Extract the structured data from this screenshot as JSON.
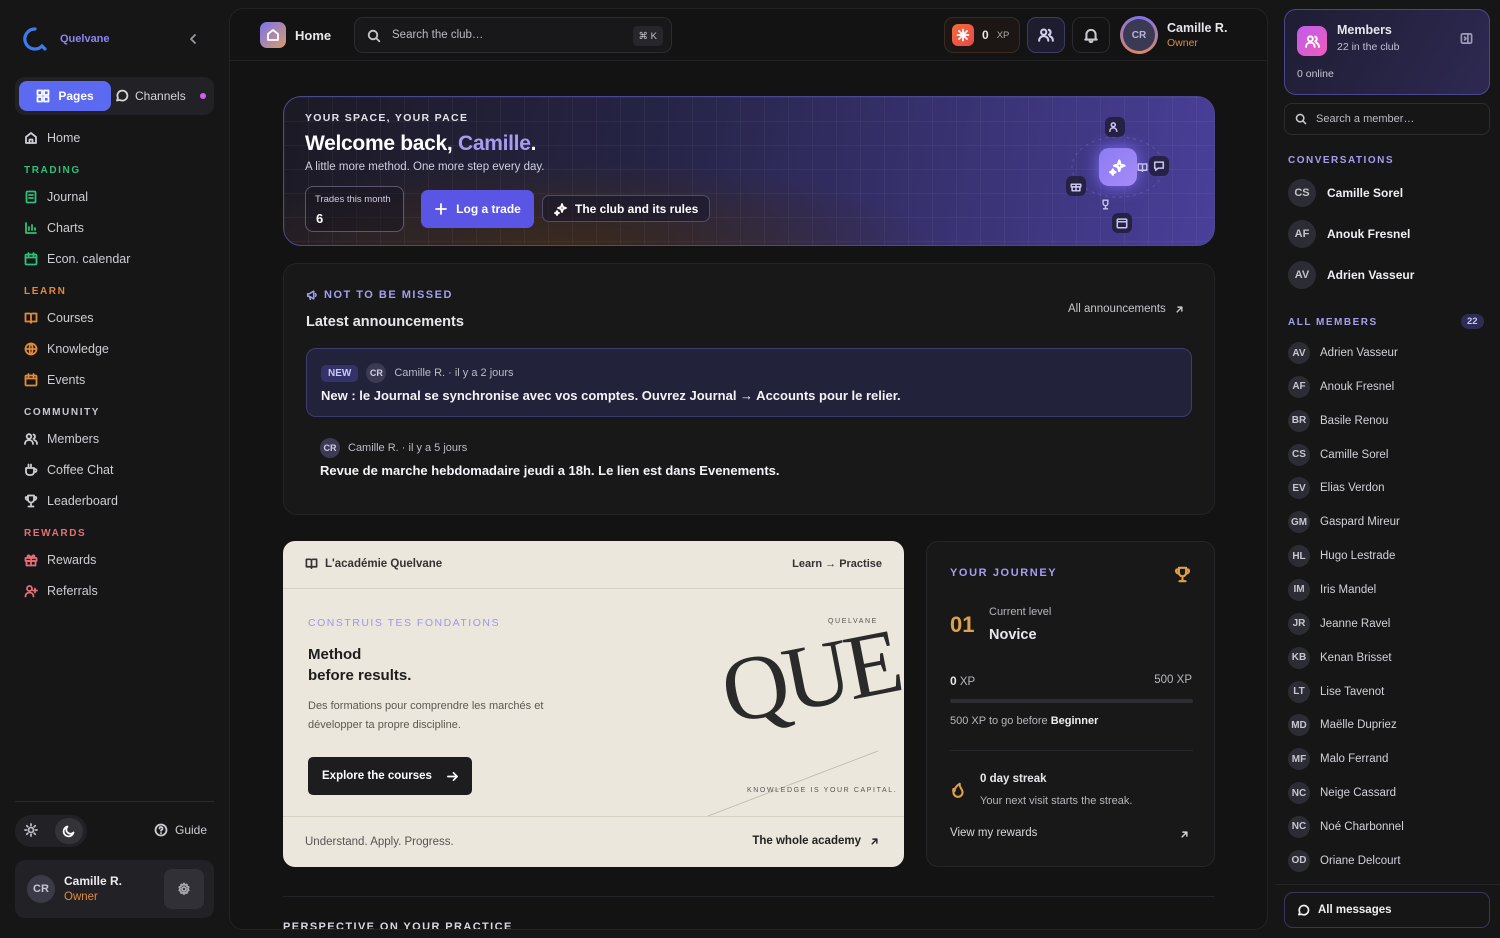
{
  "brand": {
    "name": "Quelvane"
  },
  "left_nav": {
    "tabs": {
      "pages": "Pages",
      "channels": "Channels"
    },
    "home": "Home",
    "sections": [
      {
        "title": "TRADING",
        "color": "#2fbf7a",
        "items": [
          "Journal",
          "Charts",
          "Econ. calendar"
        ]
      },
      {
        "title": "LEARN",
        "color": "#e08a3c",
        "items": [
          "Courses",
          "Knowledge",
          "Events"
        ]
      },
      {
        "title": "COMMUNITY",
        "color": "#c9c7d0",
        "items": [
          "Members",
          "Coffee Chat",
          "Leaderboard"
        ]
      },
      {
        "title": "REWARDS",
        "color": "#e36f78",
        "items": [
          "Rewards",
          "Referrals"
        ]
      }
    ],
    "guide": "Guide",
    "profile": {
      "initials": "CR",
      "name": "Camille R.",
      "role": "Owner"
    }
  },
  "topbar": {
    "page": "Home",
    "search_placeholder": "Search the club…",
    "shortcut": "⌘ K",
    "xp_value": "0",
    "xp_unit": "XP",
    "user": {
      "initials": "CR",
      "name": "Camille R.",
      "role": "Owner"
    }
  },
  "welcome": {
    "kicker": "YOUR SPACE, YOUR PACE",
    "greeting": "Welcome back, ",
    "name": "Camille",
    "period": ".",
    "subtitle": "A little more method. One more step every day.",
    "trades_label": "Trades this month",
    "trades_value": "6",
    "log_trade": "Log a trade",
    "rules": "The club and its rules"
  },
  "announcements": {
    "kicker": "NOT TO BE MISSED",
    "title": "Latest announcements",
    "all_link": "All announcements",
    "posts": [
      {
        "badge": "NEW",
        "initials": "CR",
        "meta": "Camille R. · il y a 2 jours",
        "body": "New : le Journal se synchronise avec vos comptes. Ouvrez Journal → Accounts pour le relier."
      },
      {
        "initials": "CR",
        "meta": "Camille R. · il y a 5 jours",
        "body": "Revue de marche hebdomadaire jeudi a 18h. Le lien est dans Evenements."
      }
    ]
  },
  "academy": {
    "title": "L'académie Quelvane",
    "tagline": "Learn → Practise",
    "kicker": "CONSTRUIS TES FONDATIONS",
    "heading_1": "Method",
    "heading_2": "before results.",
    "description": "Des formations pour comprendre les marchés et développer ta propre discipline.",
    "explore": "Explore the courses",
    "logo_word": "QUE",
    "logo_small": "QUELVANE",
    "logo_motto": "KNOWLEDGE IS YOUR CAPITAL.",
    "footer_left": "Understand. Apply. Progress.",
    "footer_right": "The whole academy"
  },
  "journey": {
    "kicker": "YOUR JOURNEY",
    "level_num": "01",
    "level_label": "Current level",
    "level_name": "Novice",
    "xp_now": "0",
    "xp_unit": "XP",
    "xp_max": "500 XP",
    "progress": 0,
    "to_go_prefix": "500 XP to go before ",
    "next_level": "Beginner",
    "streak_title": "0 day streak",
    "streak_desc": "Your next visit starts the streak.",
    "rewards_link": "View my rewards"
  },
  "perspective": {
    "title": "PERSPECTIVE ON YOUR PRACTICE"
  },
  "right_panel": {
    "members_title": "Members",
    "members_sub": "22 in the club",
    "online": "0 online",
    "search_placeholder": "Search a member…",
    "conversations_title": "CONVERSATIONS",
    "conversations": [
      {
        "initials": "CS",
        "name": "Camille Sorel"
      },
      {
        "initials": "AF",
        "name": "Anouk Fresnel"
      },
      {
        "initials": "AV",
        "name": "Adrien Vasseur"
      }
    ],
    "all_members_title": "ALL MEMBERS",
    "all_members_count": "22",
    "members": [
      {
        "initials": "AV",
        "name": "Adrien Vasseur"
      },
      {
        "initials": "AF",
        "name": "Anouk Fresnel"
      },
      {
        "initials": "BR",
        "name": "Basile Renou"
      },
      {
        "initials": "CS",
        "name": "Camille Sorel"
      },
      {
        "initials": "EV",
        "name": "Elias Verdon"
      },
      {
        "initials": "GM",
        "name": "Gaspard Mireur"
      },
      {
        "initials": "HL",
        "name": "Hugo Lestrade"
      },
      {
        "initials": "IM",
        "name": "Iris Mandel"
      },
      {
        "initials": "JR",
        "name": "Jeanne Ravel"
      },
      {
        "initials": "KB",
        "name": "Kenan Brisset"
      },
      {
        "initials": "LT",
        "name": "Lise Tavenot"
      },
      {
        "initials": "MD",
        "name": "Maëlle Dupriez"
      },
      {
        "initials": "MF",
        "name": "Malo Ferrand"
      },
      {
        "initials": "NC",
        "name": "Neige Cassard"
      },
      {
        "initials": "NC",
        "name": "Noé Charbonnel"
      },
      {
        "initials": "OD",
        "name": "Oriane Delcourt"
      }
    ],
    "all_messages": "All messages"
  }
}
